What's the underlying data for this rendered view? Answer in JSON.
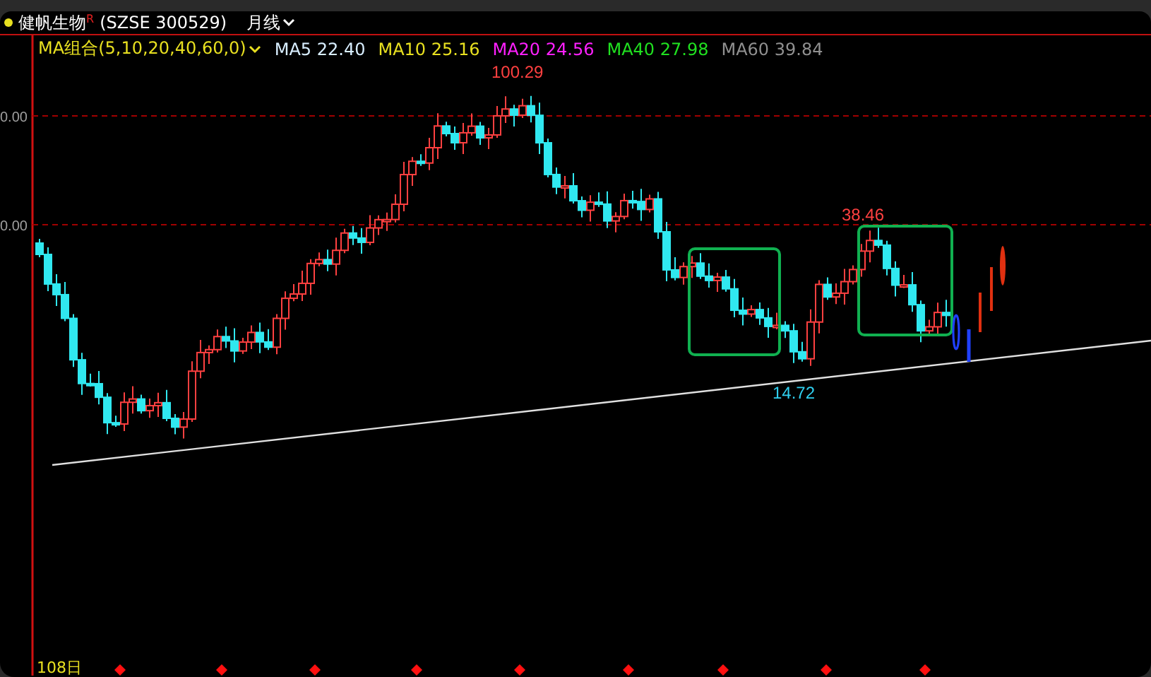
{
  "header": {
    "title": "健帆生物",
    "trademark": "R",
    "code": "(SZSE 300529)",
    "period": "月线"
  },
  "indicator": {
    "label": "MA组合(5,10,20,40,60,0)"
  },
  "ma_lines": [
    {
      "label": "MA5 22.40",
      "color": "#d8eeff"
    },
    {
      "label": "MA10 25.16",
      "color": "#e8e020"
    },
    {
      "label": "MA20 24.56",
      "color": "#ff20ff"
    },
    {
      "label": "MA40 27.98",
      "color": "#20e020"
    },
    {
      "label": "MA60 39.84",
      "color": "#909090"
    }
  ],
  "y_axis_labels": [
    "0.00",
    "0.00"
  ],
  "price_labels": [
    {
      "text": "100.29",
      "color": "#ff4040"
    },
    {
      "text": "38.46",
      "color": "#ff4040"
    },
    {
      "text": "14.72",
      "color": "#30d0f0"
    }
  ],
  "x_axis_label": "108日"
}
